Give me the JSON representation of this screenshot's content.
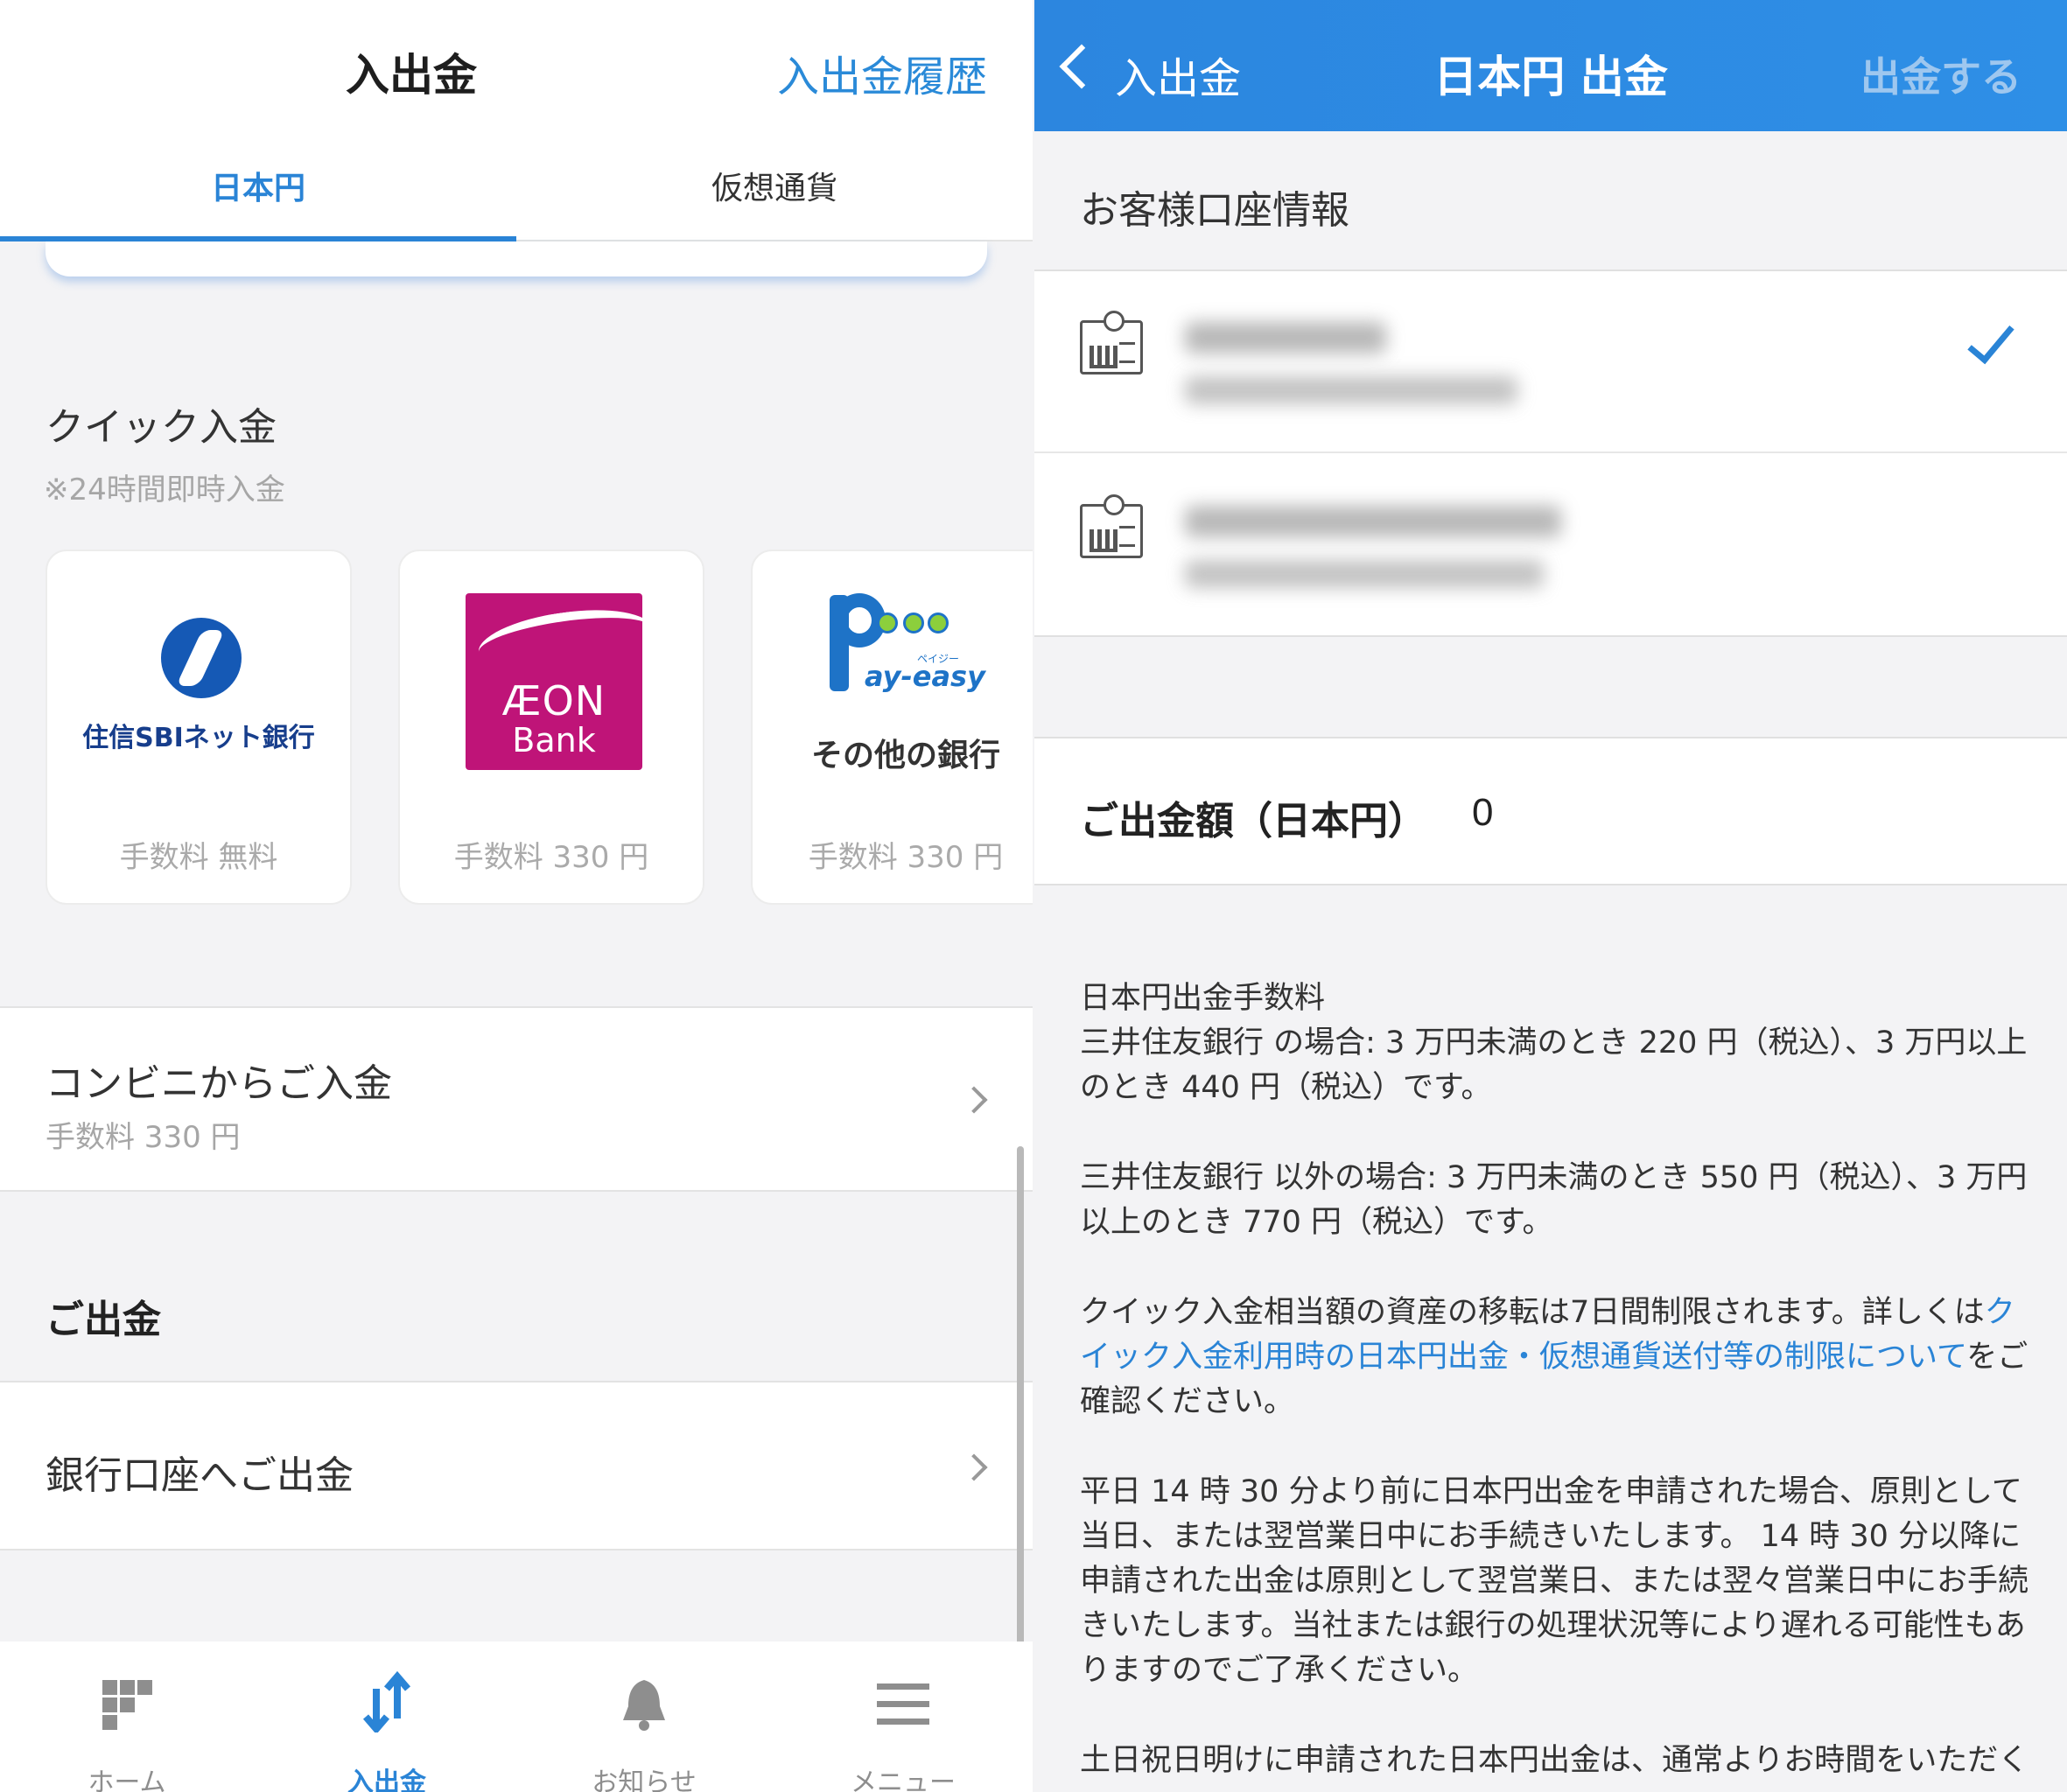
{
  "left": {
    "title": "入出金",
    "history_link": "入出金履歴",
    "tabs": [
      {
        "label": "日本円",
        "active": true
      },
      {
        "label": "仮想通貨",
        "active": false
      }
    ],
    "quick_deposit": {
      "title": "クイック入金",
      "note": "※24時間即時入金",
      "banks": [
        {
          "name": "住信SBIネット銀行",
          "fee": "手数料 無料",
          "icon": "sbi-logo-icon"
        },
        {
          "logo_text": "ÆON",
          "logo_text2": "Bank",
          "fee": "手数料 330 円",
          "icon": "aeon-bank-logo-icon"
        },
        {
          "logo_text": "ay-easy",
          "logo_small": "ペイジー",
          "name": "その他の銀行",
          "fee": "手数料 330 円",
          "icon": "pay-easy-logo-icon"
        }
      ]
    },
    "convenience": {
      "title": "コンビニからご入金",
      "fee": "手数料 330 円"
    },
    "withdraw_heading": "ご出金",
    "bank_withdraw": {
      "title": "銀行口座へご出金"
    },
    "tabbar": [
      {
        "label": "ホーム",
        "icon": "grid-home-icon",
        "active": false
      },
      {
        "label": "入出金",
        "icon": "transfer-arrows-icon",
        "active": true
      },
      {
        "label": "お知らせ",
        "icon": "bell-icon",
        "active": false
      },
      {
        "label": "メニュー",
        "icon": "hamburger-menu-icon",
        "active": false
      }
    ]
  },
  "right": {
    "back_label": "入出金",
    "title": "日本円 出金",
    "action": "出金する",
    "account_heading": "お客様口座情報",
    "accounts": [
      {
        "icon": "bank-account-icon",
        "selected": true
      },
      {
        "icon": "bank-account-icon",
        "selected": false
      }
    ],
    "amount": {
      "label": "ご出金額（日本円）",
      "value": "0"
    },
    "notes": {
      "fee_heading": "日本円出金手数料",
      "fee_smbc": "三井住友銀行 の場合: 3 万円未満のとき 220 円（税込）、3 万円以上のとき 440 円（税込）です。",
      "fee_other": "三井住友銀行 以外の場合: 3 万円未満のとき 550 円（税込）、3 万円以上のとき 770 円（税込）です。",
      "quick_pre": "クイック入金相当額の資産の移転は7日間制限されます。詳しくは",
      "quick_link": "クイック入金利用時の日本円出金・仮想通貨送付等の制限について",
      "quick_post": "をご確認ください。",
      "timing": "平日 14 時 30 分より前に日本円出金を申請された場合、原則として当日、または翌営業日中にお手続きいたします。 14 時 30 分以降に申請された出金は原則として翌営業日、または翌々営業日中にお手続きいたします。当社または銀行の処理状況等により遅れる可能性もありますのでご了承ください。",
      "weekend": "土日祝日明けに申請された日本円出金は、通常よりお時間をいただく"
    }
  },
  "colors": {
    "accent": "#2a84d6",
    "aeon": "#bf1478",
    "sbi": "#1559b5"
  }
}
